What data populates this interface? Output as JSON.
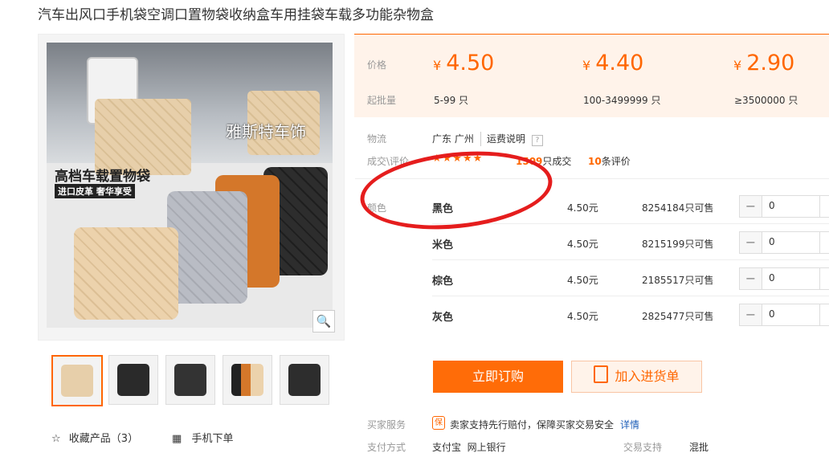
{
  "title": "汽车出风口手机袋空调口置物袋收纳盒车用挂袋车载多功能杂物盒",
  "gallery": {
    "brand_text": "雅斯特车饰",
    "ad_title": "高档车载置物袋",
    "ad_sub": "进口皮革  奢华享受",
    "zoom_icon": "🔍"
  },
  "actions_left": {
    "collect_label": "收藏产品（3）",
    "mobile_label": "手机下单"
  },
  "price_panel": {
    "price_label": "价格",
    "moq_label": "起批量",
    "currency": "¥",
    "tiers": [
      {
        "price": "4.50",
        "range": "5-99 只"
      },
      {
        "price": "4.40",
        "range": "100-3499999 只"
      },
      {
        "price": "2.90",
        "range": "≥3500000 只"
      }
    ]
  },
  "logistics": {
    "label": "物流",
    "location": "广东 广州",
    "shipping_link": "运费说明",
    "help_icon": "?"
  },
  "deals": {
    "label": "成交\\评价",
    "stars": "★★★★★",
    "sold_count": "1509",
    "sold_suffix": "只成交",
    "review_count": "10",
    "review_suffix": "条评价"
  },
  "color_label": "颜色",
  "variants": [
    {
      "name": "黑色",
      "price": "4.50元",
      "stock": "8254184只可售",
      "qty": "0"
    },
    {
      "name": "米色",
      "price": "4.50元",
      "stock": "8215199只可售",
      "qty": "0"
    },
    {
      "name": "棕色",
      "price": "4.50元",
      "stock": "2185517只可售",
      "qty": "0"
    },
    {
      "name": "灰色",
      "price": "4.50元",
      "stock": "2825477只可售",
      "qty": "0"
    }
  ],
  "buttons": {
    "buy_now": "立即订购",
    "add_to_cart": "加入进货单"
  },
  "service": {
    "label": "买家服务",
    "badge": "保",
    "text": "卖家支持先行赔付，保障买家交易安全",
    "detail_link": "详情"
  },
  "payment": {
    "label": "支付方式",
    "methods": "支付宝  网上银行",
    "trade_label": "交易支持",
    "trade_value": "混批"
  },
  "colors": {
    "accent": "#ff6600",
    "annotation": "#e51d1d"
  }
}
